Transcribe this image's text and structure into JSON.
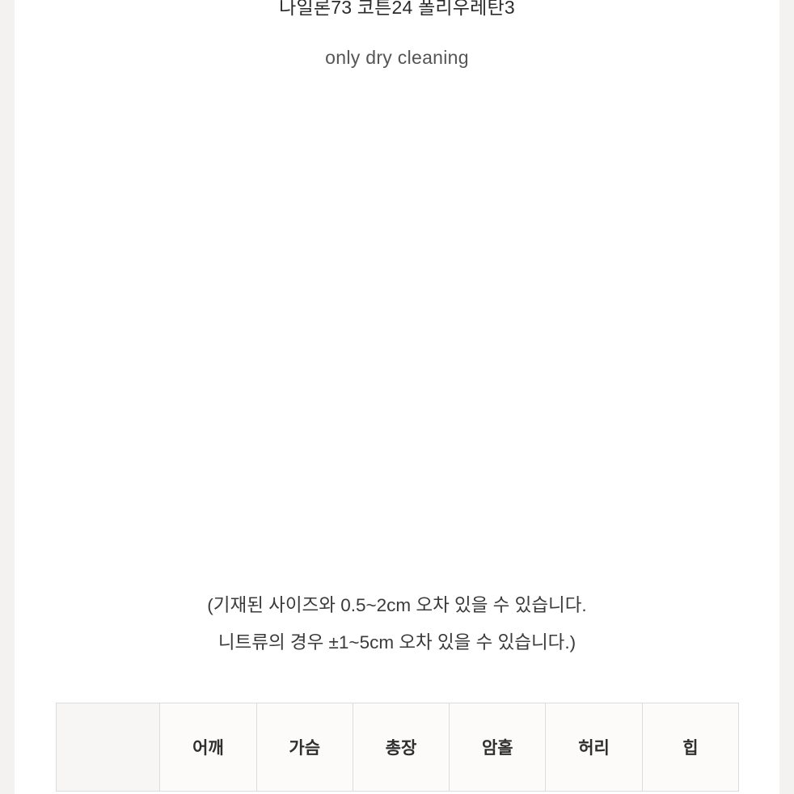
{
  "product_detail": {
    "fabric_composition": "나일론73 코튼24 폴리우레탄3",
    "care_instruction": "only dry cleaning",
    "measurement_notes": [
      "(기재된 사이즈와 0.5~2cm 오차 있을 수 있습니다.",
      "니트류의 경우 ±1~5cm 오차 있을 수 있습니다.)"
    ],
    "size_table": {
      "headers": [
        "",
        "어깨",
        "가슴",
        "총장",
        "암홀",
        "허리",
        "힙"
      ]
    }
  },
  "colors": {
    "page_background": "#ffffff",
    "gutter": "#f4f2f0",
    "text_primary": "#2b2b2b",
    "text_secondary": "#555555",
    "table_border": "#dcdcdc",
    "table_header_fill": "#f7f6f4"
  }
}
